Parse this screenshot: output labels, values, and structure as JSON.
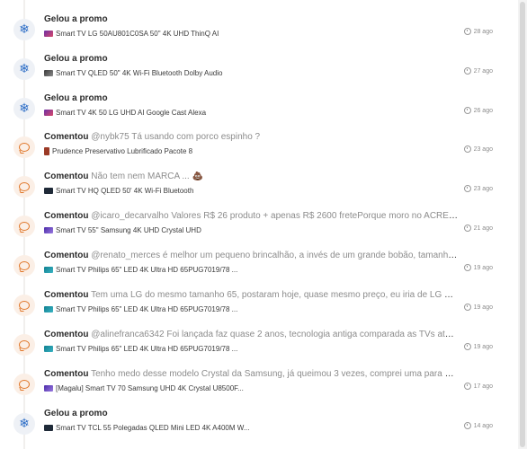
{
  "feed": {
    "items": [
      {
        "type": "freeze",
        "action": "Gelou a promo",
        "comment": "",
        "product": "Smart TV LG 50AU801C0SA 50\" 4K UHD ThinQ AI",
        "time": "28 ago",
        "thumb": "lg"
      },
      {
        "type": "freeze",
        "action": "Gelou a promo",
        "comment": "",
        "product": "Smart TV QLED 50\" 4K Wi-Fi Bluetooth Dolby Audio",
        "time": "27 ago",
        "thumb": "gray"
      },
      {
        "type": "freeze",
        "action": "Gelou a promo",
        "comment": "",
        "product": "Smart TV 4K 50 LG UHD AI Google Cast Alexa",
        "time": "26 ago",
        "thumb": "lg"
      },
      {
        "type": "comment",
        "action": "Comentou",
        "comment": "@nybk75 Tá usando com porco espinho ?",
        "product": "Prudence Preservativo Lubrificado Pacote 8",
        "time": "23 ago",
        "thumb": "red"
      },
      {
        "type": "comment",
        "action": "Comentou",
        "comment": "Não tem nem MARCA ... 💩",
        "product": "Smart TV HQ QLED 50' 4K Wi-Fi Bluetooth",
        "time": "23 ago",
        "thumb": "dark"
      },
      {
        "type": "comment",
        "action": "Comentou",
        "comment": "@icaro_decarvalho Valores R$ 26 produto + apenas R$ 2600 fretePorque moro no ACRE😒",
        "product": "Smart TV 55\" Samsung 4K UHD Crystal UHD",
        "time": "21 ago",
        "thumb": "purple"
      },
      {
        "type": "comment",
        "action": "Comentou",
        "comment": "@renato_merces é melhor um pequeno brincalhão, a invés de um grande bobão, tamanho não d...",
        "product": "Smart TV Philips 65\" LED 4K Ultra HD 65PUG7019/78 ...",
        "time": "19 ago",
        "thumb": "teal"
      },
      {
        "type": "comment",
        "action": "Comentou",
        "comment": "Tem uma LG do mesmo tamanho 65, postaram hoje, quase mesmo preço, eu iria de LG melhor do...",
        "product": "Smart TV Philips 65\" LED 4K Ultra HD 65PUG7019/78 ...",
        "time": "19 ago",
        "thumb": "teal"
      },
      {
        "type": "comment",
        "action": "Comentou",
        "comment": "@alinefranca6342 Foi lançada faz quase 2 anos, tecnologia antiga comparada as TVs atuais, essa...",
        "product": "Smart TV Philips 65\" LED 4K Ultra HD 65PUG7019/78 ...",
        "time": "19 ago",
        "thumb": "teal"
      },
      {
        "type": "comment",
        "action": "Comentou",
        "comment": "Tenho medo desse modelo Crystal da Samsung, já queimou 3 vezes, comprei uma para meu avó ...",
        "product": "[Magalu] Smart TV 70 Samsung UHD 4K Crystal U8500F...",
        "time": "17 ago",
        "thumb": "purple"
      },
      {
        "type": "freeze",
        "action": "Gelou a promo",
        "comment": "",
        "product": "Smart TV TCL 55 Polegadas QLED Mini LED 4K A400M W...",
        "time": "14 ago",
        "thumb": "dark"
      }
    ]
  }
}
